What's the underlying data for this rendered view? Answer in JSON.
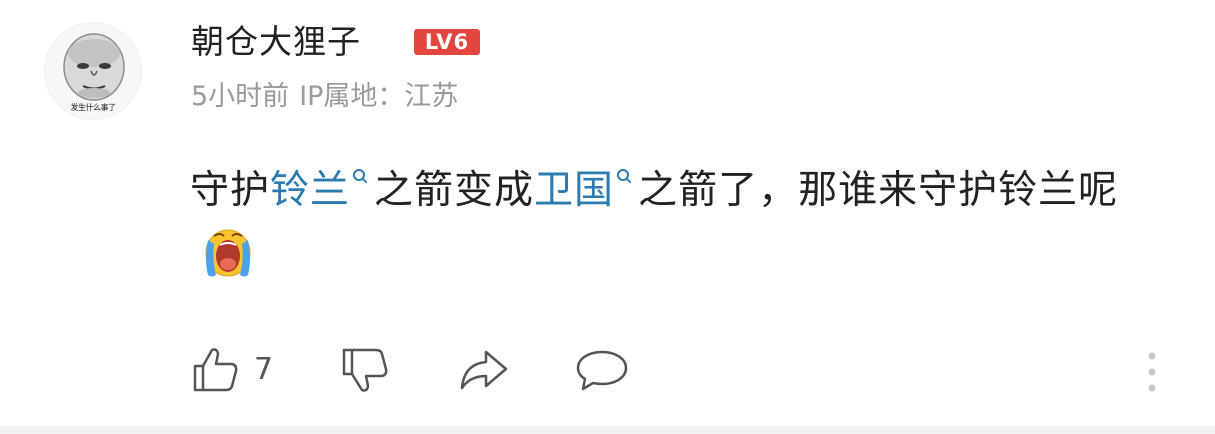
{
  "comment": {
    "avatar": {
      "icon": "meme-face-avatar",
      "caption": "发生什么事了"
    },
    "username": "朝仓大狸子",
    "level": "LV6",
    "time": "5小时前",
    "ip_location": "IP属地：江苏",
    "content": {
      "seg1": "守护",
      "keyword1": "铃兰",
      "seg2": "之箭变成",
      "keyword2": "卫国",
      "seg3": "之箭了，那谁来守护铃兰呢",
      "emoji": "crying-face-emoji"
    }
  },
  "actions": {
    "like_count": "7",
    "icons": [
      "thumbs-up-icon",
      "thumbs-down-icon",
      "share-icon",
      "comment-bubble-icon",
      "more-vertical-icon"
    ]
  },
  "colors": {
    "keyword": "#2b7bb0",
    "level_badge": "#e3463f",
    "meta_text": "#9a9a9a",
    "body_text": "#222222"
  }
}
